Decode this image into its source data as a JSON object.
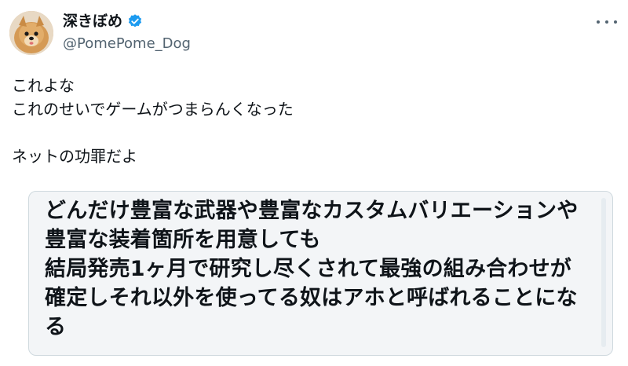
{
  "author": {
    "display_name": "深きぼめ",
    "handle": "@PomePome_Dog",
    "avatar_icon": "pomeranian-avatar",
    "verified_icon": "verified-badge-icon",
    "verified_color": "#1d9bf0"
  },
  "menu": {
    "icon": "more-icon"
  },
  "tweet": {
    "lines": [
      "これよな",
      "これのせいでゲームがつまらんくなった",
      "",
      "ネットの功罪だよ"
    ]
  },
  "quote": {
    "lines": [
      "どんだけ豊富な武器や豊富なカスタムバリエーションや",
      "豊富な装着箇所を用意しても",
      "結局発売1ヶ月で研究し尽くされて最強の組み合わせが",
      "確定しそれ以外を使ってる奴はアホと呼ばれることにな",
      "る"
    ],
    "background": "#f3f5f7",
    "border": "#cfd9de"
  }
}
